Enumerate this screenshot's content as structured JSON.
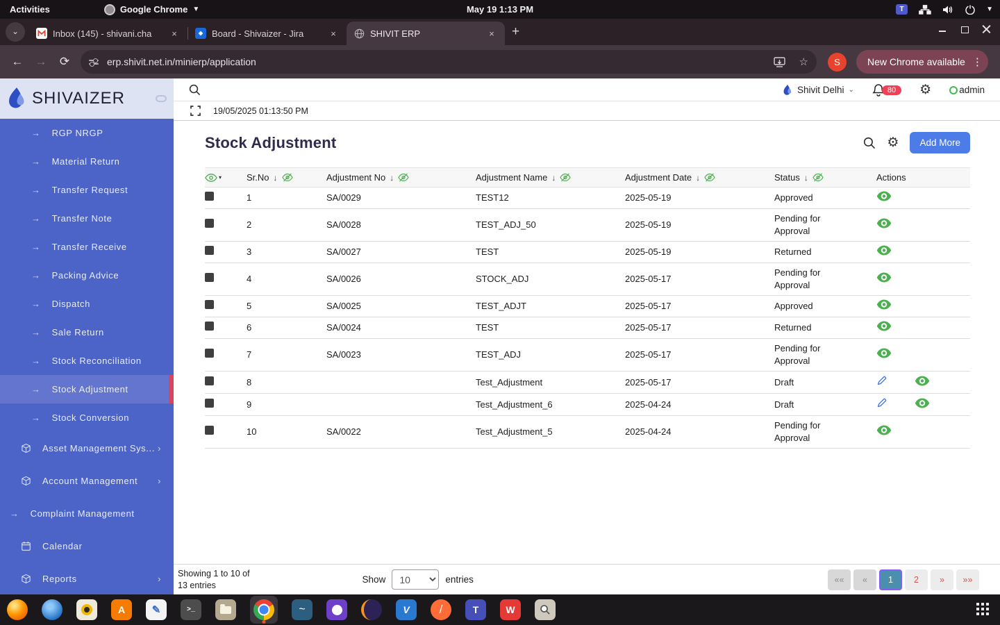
{
  "system_bar": {
    "activities_label": "Activities",
    "app_name": "Google Chrome",
    "clock": "May 19  1:13 PM"
  },
  "browser": {
    "tabs": [
      {
        "title": "Inbox (145) - shivani.cha"
      },
      {
        "title": "Board - Shivaizer - Jira"
      },
      {
        "title": "SHIVIT ERP"
      }
    ],
    "url": "erp.shivit.net.in/minierp/application",
    "profile_initial": "S",
    "update_button_label": "New Chrome available"
  },
  "sidebar": {
    "brand": "SHIVAIZER",
    "items": [
      {
        "label": "RGP NRGP"
      },
      {
        "label": "Material Return"
      },
      {
        "label": "Transfer Request"
      },
      {
        "label": "Transfer Note"
      },
      {
        "label": "Transfer Receive"
      },
      {
        "label": "Packing Advice"
      },
      {
        "label": "Dispatch"
      },
      {
        "label": "Sale Return"
      },
      {
        "label": "Stock Reconciliation"
      },
      {
        "label": "Stock Adjustment",
        "active": true
      },
      {
        "label": "Stock Conversion"
      },
      {
        "label": "Asset Management Sys..."
      },
      {
        "label": "Account Management"
      },
      {
        "label": "Complaint Management"
      },
      {
        "label": "Calendar"
      },
      {
        "label": "Reports"
      }
    ]
  },
  "app_header": {
    "location": "Shivit Delhi",
    "notification_count": "80",
    "username": "admin"
  },
  "status_row": {
    "timestamp": "19/05/2025 01:13:50 PM"
  },
  "page": {
    "title": "Stock Adjustment",
    "add_button_label": "Add More"
  },
  "table": {
    "headers": {
      "sr": "Sr.No",
      "no": "Adjustment No",
      "name": "Adjustment Name",
      "date": "Adjustment Date",
      "status": "Status",
      "actions": "Actions"
    },
    "rows": [
      {
        "sr": "1",
        "no": "SA/0029",
        "name": "TEST12",
        "date": "2025-05-19",
        "status": "Approved"
      },
      {
        "sr": "2",
        "no": "SA/0028",
        "name": "TEST_ADJ_50",
        "date": "2025-05-19",
        "status": "Pending for Approval"
      },
      {
        "sr": "3",
        "no": "SA/0027",
        "name": "TEST",
        "date": "2025-05-19",
        "status": "Returned"
      },
      {
        "sr": "4",
        "no": "SA/0026",
        "name": "STOCK_ADJ",
        "date": "2025-05-17",
        "status": "Pending for Approval"
      },
      {
        "sr": "5",
        "no": "SA/0025",
        "name": "TEST_ADJT",
        "date": "2025-05-17",
        "status": "Approved"
      },
      {
        "sr": "6",
        "no": "SA/0024",
        "name": "TEST",
        "date": "2025-05-17",
        "status": "Returned"
      },
      {
        "sr": "7",
        "no": "SA/0023",
        "name": "TEST_ADJ",
        "date": "2025-05-17",
        "status": "Pending for Approval"
      },
      {
        "sr": "8",
        "no": "",
        "name": "Test_Adjustment",
        "date": "2025-05-17",
        "status": "Draft"
      },
      {
        "sr": "9",
        "no": "",
        "name": "Test_Adjustment_6",
        "date": "2025-04-24",
        "status": "Draft"
      },
      {
        "sr": "10",
        "no": "SA/0022",
        "name": "Test_Adjustment_5",
        "date": "2025-04-24",
        "status": "Pending for Approval"
      }
    ]
  },
  "pagination": {
    "showing_line1": "Showing 1 to 10 of",
    "showing_line2": "13 entries",
    "show_label": "Show",
    "page_size": "10",
    "entries_label": "entries",
    "buttons": [
      {
        "label": "««",
        "state": "disabled"
      },
      {
        "label": "«",
        "state": "disabled"
      },
      {
        "label": "1",
        "state": "active"
      },
      {
        "label": "2",
        "state": "normal"
      },
      {
        "label": "»",
        "state": "normal"
      },
      {
        "label": "»»",
        "state": "normal"
      }
    ]
  },
  "dock": {
    "glyphs": {
      "app_center": "A",
      "text_editor": "✎",
      "terminal": ">_",
      "mysql": "~",
      "vscode": "V",
      "postman": "/",
      "teams": "T",
      "wps": "W"
    }
  },
  "colors": {
    "sidebar_blue": "#4c63c8",
    "sidebar_active": "#6375cf",
    "active_bar_red": "#d8455e",
    "add_button_blue": "#4d7ce9",
    "badge_red": "#ef4056",
    "eye_green": "#4cb050",
    "pencil_blue": "#4a7de9",
    "pager_active_bg": "#4a90ae",
    "pager_active_border": "#8a5cf5",
    "pager_red_text": "#d9534f",
    "title_navy": "#2f2a4e"
  }
}
